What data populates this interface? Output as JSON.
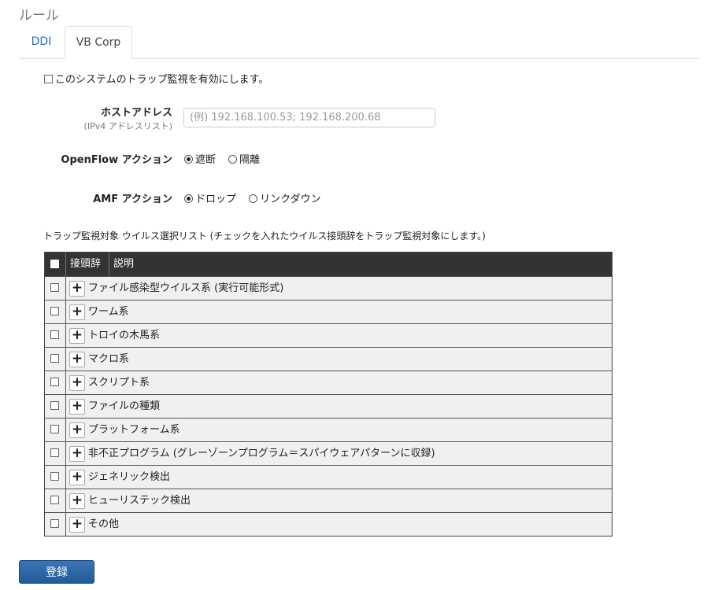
{
  "page": {
    "title": "ルール"
  },
  "tabs": [
    {
      "label": "DDI",
      "active": false
    },
    {
      "label": "VB Corp",
      "active": true
    }
  ],
  "enable_trap": {
    "label": "このシステムのトラップ監視を有効にします。",
    "checked": false
  },
  "host": {
    "label": "ホストアドレス",
    "sublabel": "(IPv4 アドレスリスト)",
    "placeholder": "(例) 192.168.100.53; 192.168.200.68",
    "value": ""
  },
  "openflow": {
    "label": "OpenFlow アクション",
    "options": [
      "遮断",
      "隔離"
    ],
    "selected": "遮断"
  },
  "amf": {
    "label": "AMF アクション",
    "options": [
      "ドロップ",
      "リンクダウン"
    ],
    "selected": "ドロップ"
  },
  "virus_list": {
    "description": "トラップ監視対象 ウイルス選択リスト (チェックを入れたウイルス接頭辞をトラップ監視対象にします。)",
    "columns": {
      "prefix": "接頭辞",
      "desc": "説明"
    },
    "rows": [
      "ファイル感染型ウイルス系 (実行可能形式)",
      "ワーム系",
      "トロイの木馬系",
      "マクロ系",
      "スクリプト系",
      "ファイルの種類",
      "プラットフォーム系",
      "非不正プログラム (グレーゾーンプログラム＝スパイウェアパターンに収録)",
      "ジェネリック検出",
      "ヒューリステック検出",
      "その他"
    ]
  },
  "submit": {
    "label": "登録"
  },
  "icons": {
    "expand": "plus-icon"
  },
  "colors": {
    "accent": "#2a6ebb",
    "header_bg": "#333333",
    "row_bg": "#f0f0f0",
    "button": "#2d67a8"
  }
}
